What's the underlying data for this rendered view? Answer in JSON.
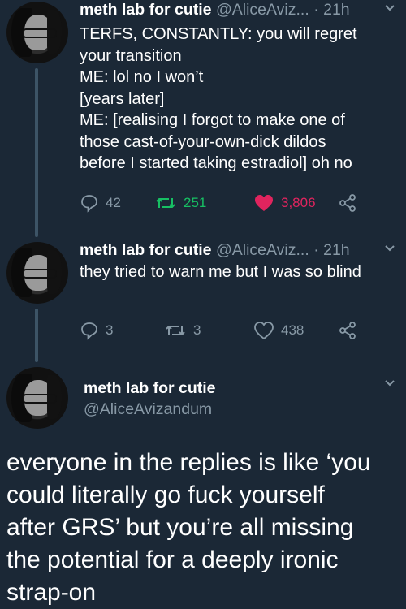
{
  "tweets": [
    {
      "name": "meth lab for cutie",
      "handle": "@AliceAviz...",
      "time": "· 21h",
      "text_lines": [
        "TERFS, CONSTANTLY: you will regret",
        "your transition",
        "ME: lol no I won’t",
        "[years later]",
        "ME: [realising I forgot to make one of",
        "those cast-of-your-own-dick dildos",
        "before I started taking estradiol] oh no"
      ],
      "replies": "42",
      "retweets": "251",
      "likes": "3,806"
    },
    {
      "name": "meth lab for cutie",
      "handle": "@AliceAviz...",
      "time": "· 21h",
      "text_lines": [
        "they tried to warn me but I was so blind"
      ],
      "replies": "3",
      "retweets": "3",
      "likes": "438"
    }
  ],
  "main": {
    "name": "meth lab for cutie",
    "handle": "@AliceAvizandum",
    "text_lines": [
      "everyone in the replies is like ‘you",
      "could literally go fuck yourself",
      "after GRS’ but you’re all missing",
      "the potential for a deeply ironic",
      "strap-on"
    ]
  },
  "icons": {
    "reply": "reply-icon",
    "retweet": "retweet-icon",
    "like": "heart-icon",
    "share": "share-icon",
    "more": "chevron-down-icon"
  },
  "colors": {
    "background": "#1b2836",
    "muted": "#8899a6",
    "retweet_active": "#17bf63",
    "like_active": "#e0245e"
  }
}
